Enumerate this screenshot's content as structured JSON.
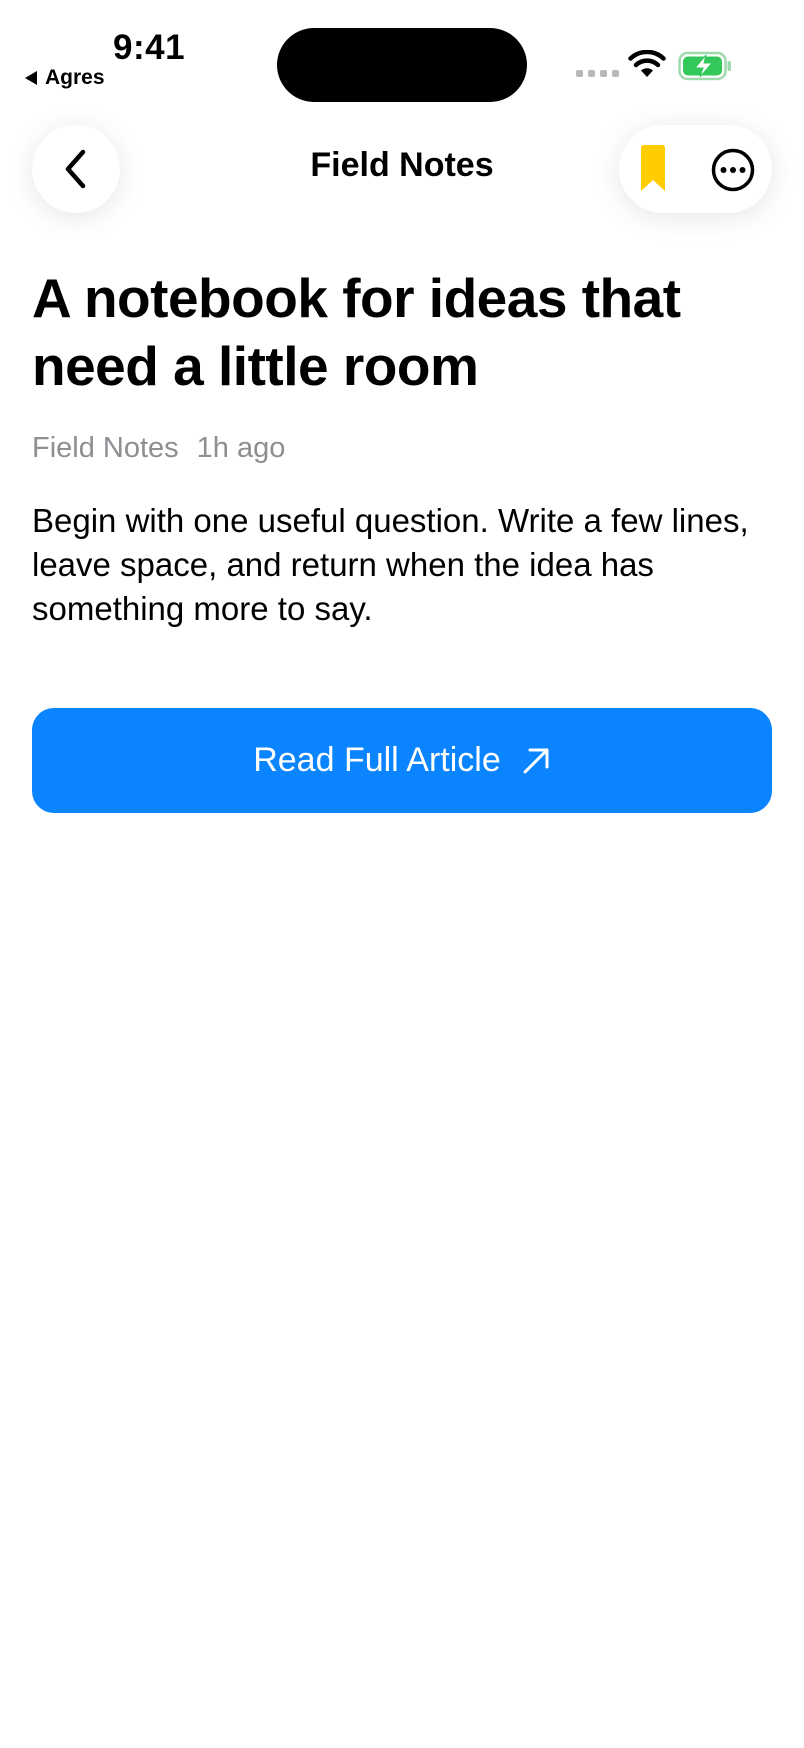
{
  "status_bar": {
    "time": "9:41",
    "back_app_label": "Agres"
  },
  "nav": {
    "title": "Field Notes",
    "bookmark_active_color": "#FFCC00",
    "icons": [
      "chevron-left-icon",
      "bookmark-icon",
      "more-icon"
    ]
  },
  "article": {
    "headline": "A notebook for ideas that need a little room",
    "source": "Field Notes",
    "time_ago": "1h ago",
    "body": "Begin with one useful question. Write a few lines, leave space, and return when the idea has something more to say.",
    "cta_label": "Read Full Article",
    "cta_color": "#0A84FF"
  }
}
